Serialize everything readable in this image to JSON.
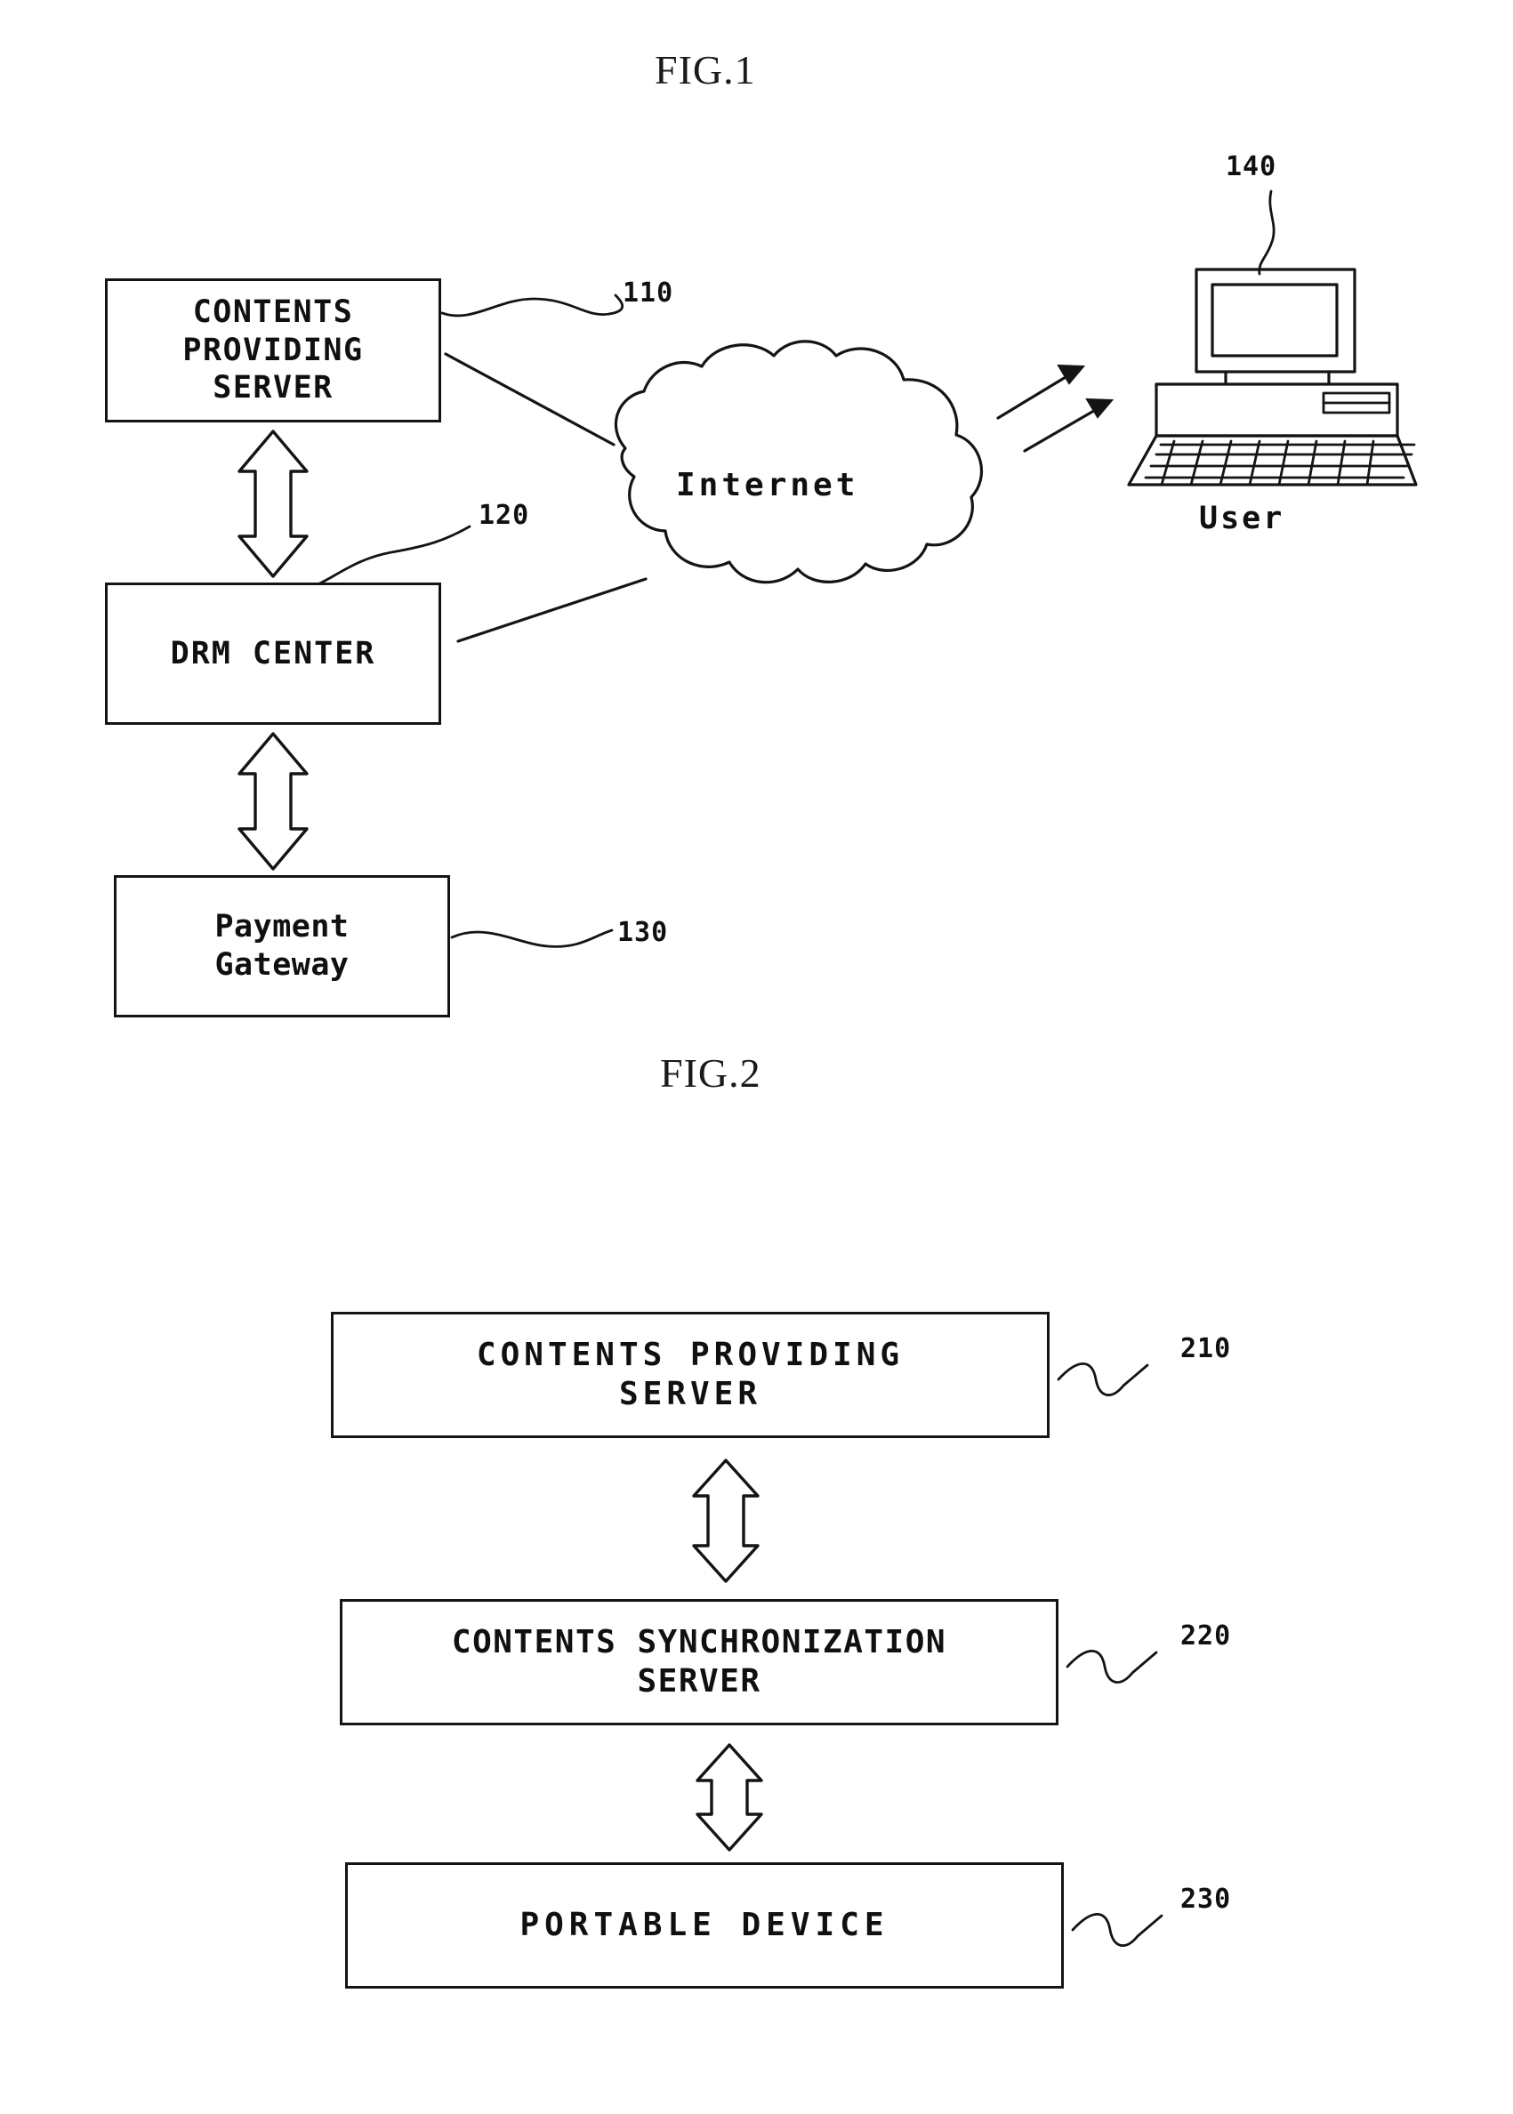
{
  "document": {
    "kind": "patent-drawing-sheet",
    "figures": [
      {
        "id": "fig1",
        "title": "FIG.1",
        "nodes": [
          {
            "name": "contents-providing-server",
            "label": "CONTENTS\nPROVIDING\nSERVER",
            "ref": "110"
          },
          {
            "name": "drm-center",
            "label": "DRM CENTER",
            "ref": "120"
          },
          {
            "name": "payment-gateway",
            "label": "Payment\nGateway",
            "ref": "130"
          },
          {
            "name": "internet-cloud",
            "label": "Internet",
            "ref": ""
          },
          {
            "name": "user-computer",
            "label": "User",
            "ref": "140"
          }
        ]
      },
      {
        "id": "fig2",
        "title": "FIG.2",
        "nodes": [
          {
            "name": "contents-providing-server",
            "label": "CONTENTS PROVIDING\nSERVER",
            "ref": "210"
          },
          {
            "name": "contents-synchronization-server",
            "label": "CONTENTS SYNCHRONIZATION\nSERVER",
            "ref": "220"
          },
          {
            "name": "portable-device",
            "label": "PORTABLE DEVICE",
            "ref": "230"
          }
        ]
      }
    ]
  },
  "fig1": {
    "title": "FIG.1",
    "contents_providing_server": {
      "label": "CONTENTS\nPROVIDING\nSERVER",
      "ref": "110"
    },
    "drm_center": {
      "label": "DRM CENTER",
      "ref": "120"
    },
    "payment_gateway": {
      "label": "Payment\nGateway",
      "ref": "130"
    },
    "internet": {
      "label": "Internet"
    },
    "user": {
      "label": "User",
      "ref": "140"
    }
  },
  "fig2": {
    "title": "FIG.2",
    "contents_providing_server": {
      "label": "CONTENTS PROVIDING\nSERVER",
      "ref": "210"
    },
    "contents_synchronization_server": {
      "label": "CONTENTS SYNCHRONIZATION\nSERVER",
      "ref": "220"
    },
    "portable_device": {
      "label": "PORTABLE DEVICE",
      "ref": "230"
    }
  },
  "style": {
    "ink": "#141414",
    "paper": "#ffffff"
  }
}
